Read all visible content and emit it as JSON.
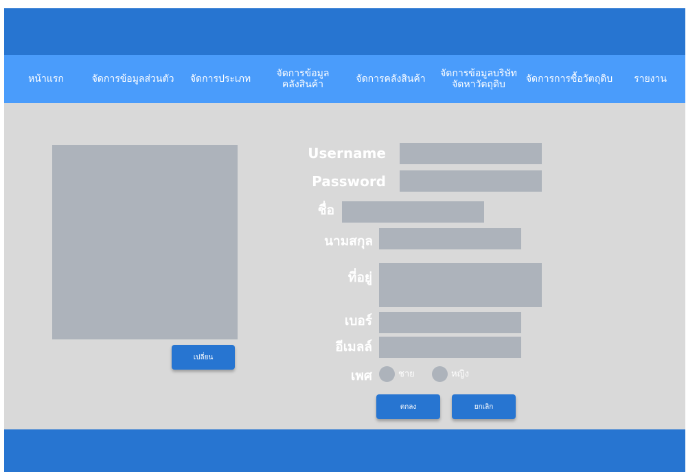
{
  "nav": {
    "items": [
      {
        "label": "หน้าแรก"
      },
      {
        "label": "จัดการข้อมูลส่วนตัว"
      },
      {
        "label": "จัดการประเภท"
      },
      {
        "label": "จัดการข้อมูล\nคลังสินค้า"
      },
      {
        "label": "จัดการคลังสินค้า"
      },
      {
        "label": "จัดการข้อมูลบริษัท\nจัดหาวัตถุดิบ"
      },
      {
        "label": "จัดการการซื้อวัตถุดิบ"
      },
      {
        "label": "รายงาน"
      }
    ]
  },
  "profile": {
    "change_button": "เปลี่ยน"
  },
  "form": {
    "username_label": "Username",
    "password_label": "Password",
    "firstname_label": "ชื่อ",
    "lastname_label": "นามสกุล",
    "address_label": "ที่อยู่",
    "phone_label": "เบอร์",
    "email_label": "อีเมลล์",
    "gender_label": "เพศ",
    "gender_options": [
      "ชาย",
      "หญิง"
    ],
    "confirm_button": "ตกลง",
    "cancel_button": "ยกเลิก"
  },
  "colors": {
    "header": "#2775d1",
    "nav": "#4a9cfb",
    "background": "#d9d9d9",
    "field": "#adb3bb"
  }
}
